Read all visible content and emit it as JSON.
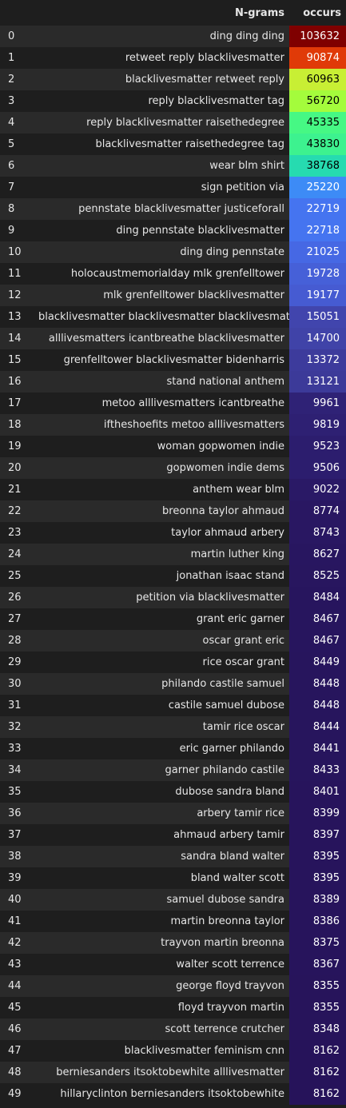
{
  "table": {
    "headers": {
      "index": "",
      "ngrams": "N-grams",
      "occurs": "occurs"
    },
    "rows": [
      {
        "idx": "0",
        "ngram": "ding ding ding",
        "occurs": "103632",
        "bg": "#7f0000",
        "fg": "#ffffff"
      },
      {
        "idx": "1",
        "ngram": "retweet reply blacklivesmatter",
        "occurs": "90874",
        "bg": "#e03a08",
        "fg": "#ffffff"
      },
      {
        "idx": "2",
        "ngram": "blacklivesmatter retweet reply",
        "occurs": "60963",
        "bg": "#c8ef34",
        "fg": "#000000"
      },
      {
        "idx": "3",
        "ngram": "reply blacklivesmatter tag",
        "occurs": "56720",
        "bg": "#a4fc3c",
        "fg": "#000000"
      },
      {
        "idx": "4",
        "ngram": "reply blacklivesmatter raisethedegree",
        "occurs": "45335",
        "bg": "#46f884",
        "fg": "#000000"
      },
      {
        "idx": "5",
        "ngram": "blacklivesmatter raisethedegree tag",
        "occurs": "43830",
        "bg": "#3df28f",
        "fg": "#000000"
      },
      {
        "idx": "6",
        "ngram": "wear blm shirt",
        "occurs": "38768",
        "bg": "#26dbb0",
        "fg": "#000000"
      },
      {
        "idx": "7",
        "ngram": "sign petition via",
        "occurs": "25220",
        "bg": "#3d8bf6",
        "fg": "#ffffff"
      },
      {
        "idx": "8",
        "ngram": "pennstate blacklivesmatter justiceforall",
        "occurs": "22719",
        "bg": "#4574f0",
        "fg": "#ffffff"
      },
      {
        "idx": "9",
        "ngram": "ding pennstate blacklivesmatter",
        "occurs": "22718",
        "bg": "#4574f0",
        "fg": "#ffffff"
      },
      {
        "idx": "10",
        "ngram": "ding ding pennstate",
        "occurs": "21025",
        "bg": "#4668e4",
        "fg": "#ffffff"
      },
      {
        "idx": "11",
        "ngram": "holocaustmemorialday mlk grenfelltower",
        "occurs": "19728",
        "bg": "#4660d8",
        "fg": "#ffffff"
      },
      {
        "idx": "12",
        "ngram": "mlk grenfelltower blacklivesmatter",
        "occurs": "19177",
        "bg": "#465bd2",
        "fg": "#ffffff"
      },
      {
        "idx": "13",
        "ngram": "blacklivesmatter blacklivesmatter blacklivesmatter",
        "occurs": "15051",
        "bg": "#4145ad",
        "fg": "#ffffff"
      },
      {
        "idx": "14",
        "ngram": "alllivesmatters icantbreathe blacklivesmatter",
        "occurs": "14700",
        "bg": "#4043a8",
        "fg": "#ffffff"
      },
      {
        "idx": "15",
        "ngram": "grenfelltower blacklivesmatter bidenharris",
        "occurs": "13372",
        "bg": "#3d3b9c",
        "fg": "#ffffff"
      },
      {
        "idx": "16",
        "ngram": "stand national anthem",
        "occurs": "13121",
        "bg": "#3c3a99",
        "fg": "#ffffff"
      },
      {
        "idx": "17",
        "ngram": "metoo alllivesmatters icantbreathe",
        "occurs": "9961",
        "bg": "#2f2276",
        "fg": "#ffffff"
      },
      {
        "idx": "18",
        "ngram": "iftheshoefits metoo alllivesmatters",
        "occurs": "9819",
        "bg": "#2e2073",
        "fg": "#ffffff"
      },
      {
        "idx": "19",
        "ngram": "woman gopwomen indie",
        "occurs": "9523",
        "bg": "#2c1d6e",
        "fg": "#ffffff"
      },
      {
        "idx": "20",
        "ngram": "gopwomen indie dems",
        "occurs": "9506",
        "bg": "#2c1d6e",
        "fg": "#ffffff"
      },
      {
        "idx": "21",
        "ngram": "anthem wear blm",
        "occurs": "9022",
        "bg": "#2a1966",
        "fg": "#ffffff"
      },
      {
        "idx": "22",
        "ngram": "breonna taylor ahmaud",
        "occurs": "8774",
        "bg": "#291762",
        "fg": "#ffffff"
      },
      {
        "idx": "23",
        "ngram": "taylor ahmaud arbery",
        "occurs": "8743",
        "bg": "#291762",
        "fg": "#ffffff"
      },
      {
        "idx": "24",
        "ngram": "martin luther king",
        "occurs": "8627",
        "bg": "#281660",
        "fg": "#ffffff"
      },
      {
        "idx": "25",
        "ngram": "jonathan isaac stand",
        "occurs": "8525",
        "bg": "#28165f",
        "fg": "#ffffff"
      },
      {
        "idx": "26",
        "ngram": "petition via blacklivesmatter",
        "occurs": "8484",
        "bg": "#27155e",
        "fg": "#ffffff"
      },
      {
        "idx": "27",
        "ngram": "grant eric garner",
        "occurs": "8467",
        "bg": "#27155e",
        "fg": "#ffffff"
      },
      {
        "idx": "28",
        "ngram": "oscar grant eric",
        "occurs": "8467",
        "bg": "#27155e",
        "fg": "#ffffff"
      },
      {
        "idx": "29",
        "ngram": "rice oscar grant",
        "occurs": "8449",
        "bg": "#27155d",
        "fg": "#ffffff"
      },
      {
        "idx": "30",
        "ngram": "philando castile samuel",
        "occurs": "8448",
        "bg": "#27155d",
        "fg": "#ffffff"
      },
      {
        "idx": "31",
        "ngram": "castile samuel dubose",
        "occurs": "8448",
        "bg": "#27155d",
        "fg": "#ffffff"
      },
      {
        "idx": "32",
        "ngram": "tamir rice oscar",
        "occurs": "8444",
        "bg": "#27155d",
        "fg": "#ffffff"
      },
      {
        "idx": "33",
        "ngram": "eric garner philando",
        "occurs": "8441",
        "bg": "#27155d",
        "fg": "#ffffff"
      },
      {
        "idx": "34",
        "ngram": "garner philando castile",
        "occurs": "8433",
        "bg": "#27155d",
        "fg": "#ffffff"
      },
      {
        "idx": "35",
        "ngram": "dubose sandra bland",
        "occurs": "8401",
        "bg": "#27145c",
        "fg": "#ffffff"
      },
      {
        "idx": "36",
        "ngram": "arbery tamir rice",
        "occurs": "8399",
        "bg": "#27145c",
        "fg": "#ffffff"
      },
      {
        "idx": "37",
        "ngram": "ahmaud arbery tamir",
        "occurs": "8397",
        "bg": "#27145c",
        "fg": "#ffffff"
      },
      {
        "idx": "38",
        "ngram": "sandra bland walter",
        "occurs": "8395",
        "bg": "#27145c",
        "fg": "#ffffff"
      },
      {
        "idx": "39",
        "ngram": "bland walter scott",
        "occurs": "8395",
        "bg": "#27145c",
        "fg": "#ffffff"
      },
      {
        "idx": "40",
        "ngram": "samuel dubose sandra",
        "occurs": "8389",
        "bg": "#27145c",
        "fg": "#ffffff"
      },
      {
        "idx": "41",
        "ngram": "martin breonna taylor",
        "occurs": "8386",
        "bg": "#27145c",
        "fg": "#ffffff"
      },
      {
        "idx": "42",
        "ngram": "trayvon martin breonna",
        "occurs": "8375",
        "bg": "#27145c",
        "fg": "#ffffff"
      },
      {
        "idx": "43",
        "ngram": "walter scott terrence",
        "occurs": "8367",
        "bg": "#27145c",
        "fg": "#ffffff"
      },
      {
        "idx": "44",
        "ngram": "george floyd trayvon",
        "occurs": "8355",
        "bg": "#27145b",
        "fg": "#ffffff"
      },
      {
        "idx": "45",
        "ngram": "floyd trayvon martin",
        "occurs": "8355",
        "bg": "#27145b",
        "fg": "#ffffff"
      },
      {
        "idx": "46",
        "ngram": "scott terrence crutcher",
        "occurs": "8348",
        "bg": "#27145b",
        "fg": "#ffffff"
      },
      {
        "idx": "47",
        "ngram": "blacklivesmatter feminism cnn",
        "occurs": "8162",
        "bg": "#26135a",
        "fg": "#ffffff"
      },
      {
        "idx": "48",
        "ngram": "berniesanders itsoktobewhite alllivesmatter",
        "occurs": "8162",
        "bg": "#26135a",
        "fg": "#ffffff"
      },
      {
        "idx": "49",
        "ngram": "hillaryclinton berniesanders itsoktobewhite",
        "occurs": "8162",
        "bg": "#26135a",
        "fg": "#ffffff"
      }
    ]
  }
}
